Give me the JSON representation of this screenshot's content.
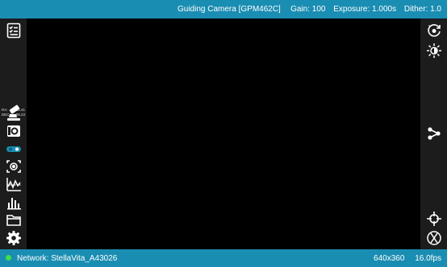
{
  "header": {
    "camera_title": "Guiding Camera [GPM462C]",
    "gain": "Gain: 100",
    "exposure": "Exposure: 1.000s",
    "dither": "Dither: 1.0"
  },
  "left_toolbar": {
    "icons": [
      "checklist-icon",
      "telescope-icon",
      "camera-icon",
      "filter-wheel-icon",
      "focus-icon",
      "guide-graph-icon",
      "histogram-icon",
      "folder-icon",
      "settings-icon"
    ],
    "ra_label": "RA:",
    "ra_value": "18.41",
    "dec_label": "DEC:",
    "dec_value": "89.23"
  },
  "right_toolbar": {
    "icons": [
      "loop-exposure-icon",
      "brightness-icon",
      "share-icon",
      "crosshair-icon",
      "reticle-icon"
    ]
  },
  "footer": {
    "network": "Network: StellaVita_A43026",
    "resolution": "640x360",
    "fps": "16.0fps",
    "status_color": "#3ee04a"
  },
  "colors": {
    "accent": "#1a8db2",
    "panel": "#1c1c1c",
    "viewport": "#000000"
  }
}
